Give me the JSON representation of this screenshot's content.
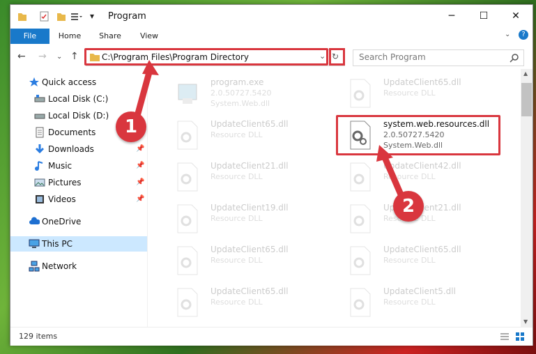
{
  "window": {
    "title": "Program"
  },
  "ribbon": {
    "tabs": [
      "File",
      "Home",
      "Share",
      "View"
    ]
  },
  "nav": {
    "address": "C:\\Program Files\\Program Directory",
    "search_placeholder": "Search Program"
  },
  "sidebar": {
    "items": [
      {
        "label": "Quick access",
        "icon": "star-icon"
      },
      {
        "label": "Local Disk (C:)",
        "icon": "drive-icon"
      },
      {
        "label": "Local Disk (D:)",
        "icon": "drive-icon"
      },
      {
        "label": "Documents",
        "icon": "documents-icon"
      },
      {
        "label": "Downloads",
        "icon": "downloads-icon"
      },
      {
        "label": "Music",
        "icon": "music-icon"
      },
      {
        "label": "Pictures",
        "icon": "pictures-icon"
      },
      {
        "label": "Videos",
        "icon": "videos-icon"
      },
      {
        "label": "OneDrive",
        "icon": "cloud-icon"
      },
      {
        "label": "This PC",
        "icon": "pc-icon"
      },
      {
        "label": "Network",
        "icon": "network-icon"
      }
    ]
  },
  "files": [
    {
      "name": "program.exe",
      "line2": "2.0.50727.5420",
      "line3": "System.Web.dll"
    },
    {
      "name": "UpdateClient65.dll",
      "line2": "Resource DLL",
      "line3": ""
    },
    {
      "name": "UpdateClient65.dll",
      "line2": "Resource DLL",
      "line3": ""
    },
    {
      "name": "system.web.resources.dll",
      "line2": "2.0.50727.5420",
      "line3": "System.Web.dll"
    },
    {
      "name": "UpdateClient21.dll",
      "line2": "Resource DLL",
      "line3": ""
    },
    {
      "name": "UpdateClient42.dll",
      "line2": "Resource DLL",
      "line3": ""
    },
    {
      "name": "UpdateClient19.dll",
      "line2": "Resource DLL",
      "line3": ""
    },
    {
      "name": "UpdateClient21.dll",
      "line2": "Resource DLL",
      "line3": ""
    },
    {
      "name": "UpdateClient65.dll",
      "line2": "Resource DLL",
      "line3": ""
    },
    {
      "name": "UpdateClient65.dll",
      "line2": "Resource DLL",
      "line3": ""
    },
    {
      "name": "UpdateClient65.dll",
      "line2": "Resource DLL",
      "line3": ""
    },
    {
      "name": "UpdateClient5.dll",
      "line2": "Resource DLL",
      "line3": ""
    }
  ],
  "status": {
    "count": "129 items"
  },
  "annotations": {
    "step1": "1",
    "step2": "2"
  },
  "colors": {
    "accent": "#1979ca",
    "highlight": "#d9363e",
    "selected": "#cce8ff"
  }
}
